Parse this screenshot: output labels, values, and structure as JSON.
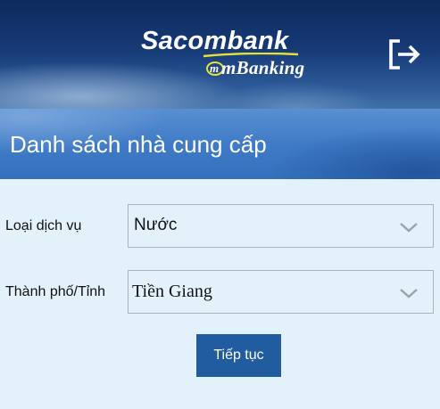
{
  "header": {
    "brand_name": "Sacombank",
    "brand_sub": "mBanking",
    "logout_icon": "logout-icon"
  },
  "page": {
    "title": "Danh sách nhà cung cấp"
  },
  "form": {
    "service_type": {
      "label": "Loại dịch vụ",
      "value": "Nước"
    },
    "province": {
      "label": "Thành phố/Tỉnh",
      "value": "Tiền Giang"
    },
    "submit_label": "Tiếp tục"
  },
  "colors": {
    "header_dark": "#0f2a5c",
    "title_bar": "#3f7bc6",
    "page_background": "#e3f1fb",
    "button": "#215d9e",
    "logo_swoosh": "#e8e03a"
  }
}
